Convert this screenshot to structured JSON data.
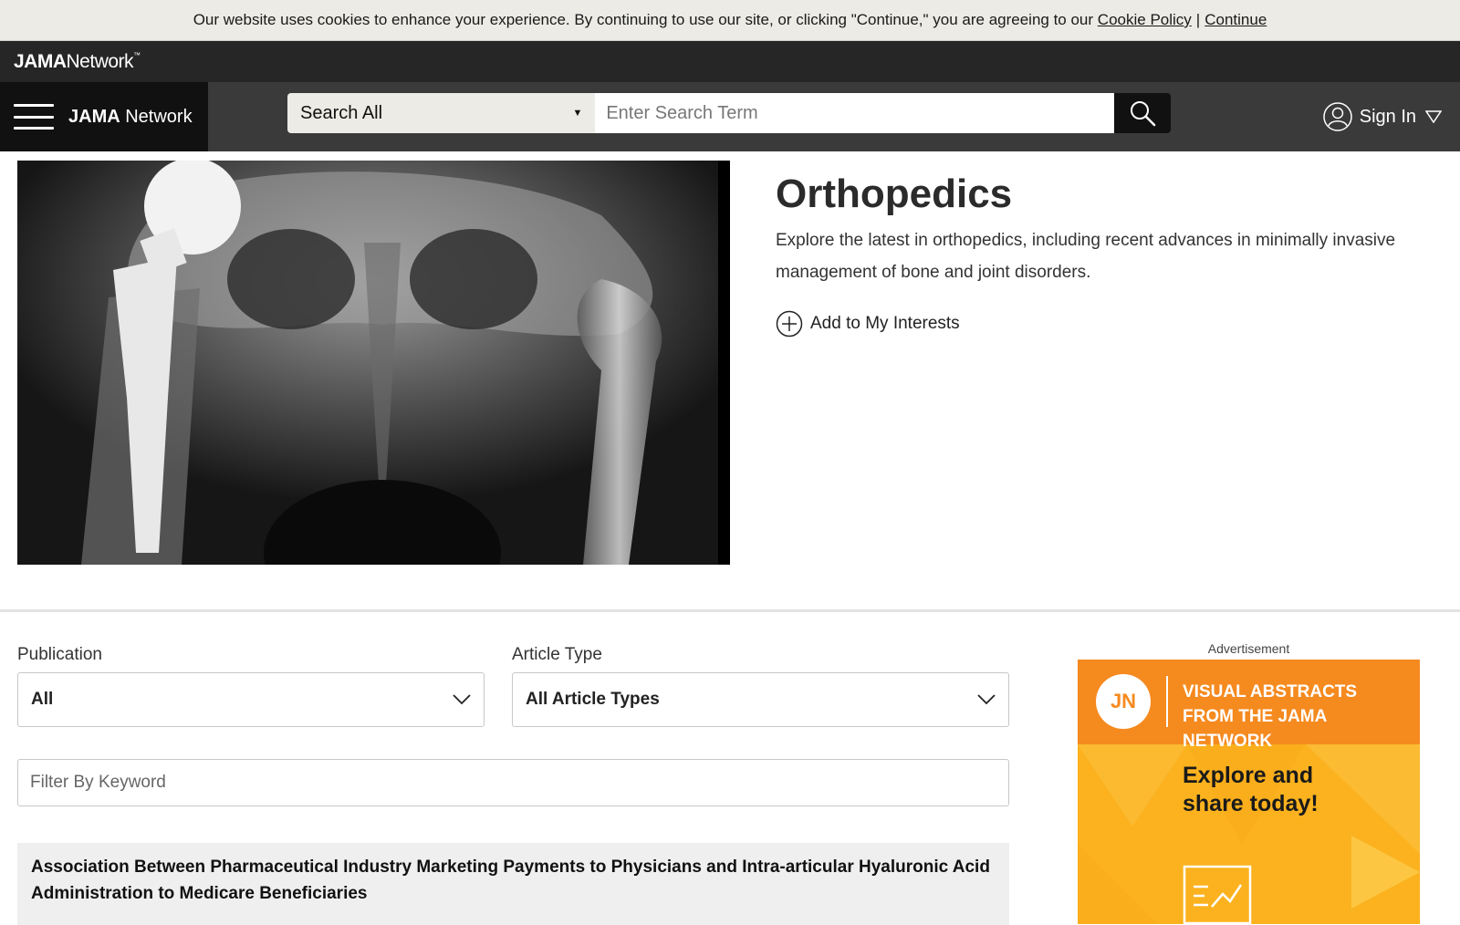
{
  "cookie_banner": {
    "message": "Our website uses cookies to enhance your experience. By continuing to use our site, or clicking \"Continue,\" you are agreeing to our",
    "policy_link": "Cookie Policy",
    "separator": "|",
    "continue_link": "Continue"
  },
  "brand": {
    "logo_bold": "JAMA",
    "logo_rest": "Network",
    "logo_tm": "™"
  },
  "nav": {
    "menu_icon": "hamburger-menu-icon",
    "title_bold": "JAMA",
    "title_rest": "Network",
    "search_scope": "Search All",
    "search_placeholder": "Enter Search Term",
    "search_icon": "search-icon",
    "sign_in": "Sign In",
    "user_icon": "user-circle-icon",
    "dropdown_icon": "triangle-down-icon"
  },
  "hero": {
    "image_alt": "X-ray of pelvis with hip replacement implant",
    "title": "Orthopedics",
    "description": "Explore the latest in orthopedics, including recent advances in minimally invasive management of bone and joint disorders.",
    "add_interest": "Add to My Interests",
    "add_icon": "plus-circle-icon"
  },
  "filters": {
    "publication_label": "Publication",
    "publication_value": "All",
    "article_type_label": "Article Type",
    "article_type_value": "All Article Types",
    "keyword_placeholder": "Filter By Keyword",
    "chevron_icon": "chevron-down-icon"
  },
  "articles": [
    {
      "title": "Association Between Pharmaceutical Industry Marketing Payments to Physicians and Intra-articular Hyaluronic Acid Administration to Medicare Beneficiaries"
    }
  ],
  "ad": {
    "label": "Advertisement",
    "logo": "JN",
    "headline_1": "VISUAL ABSTRACTS",
    "headline_2": "FROM THE JAMA NETWORK",
    "cta_1": "Explore and",
    "cta_2": "share today!",
    "colors": {
      "orange": "#f58a1f",
      "yellow": "#fbb21e"
    }
  },
  "colors": {
    "nav_dark": "#3a3a3a",
    "brand_bar": "#262626",
    "cookie_bg": "#ecebe5"
  }
}
